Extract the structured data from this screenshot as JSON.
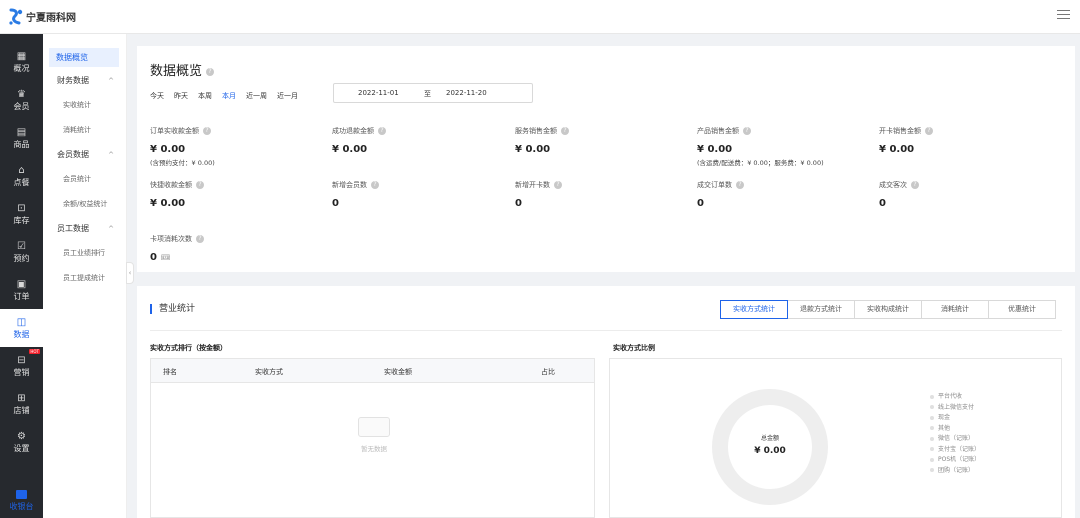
{
  "app": {
    "logo_text": "宁夏雨科网"
  },
  "leftnav": [
    {
      "label": "概况",
      "icon": "grid-icon"
    },
    {
      "label": "会员",
      "icon": "crown-icon"
    },
    {
      "label": "商品",
      "icon": "box-icon"
    },
    {
      "label": "点餐",
      "icon": "dish-icon"
    },
    {
      "label": "库存",
      "icon": "warehouse-icon"
    },
    {
      "label": "预约",
      "icon": "calendar-check-icon"
    },
    {
      "label": "订单",
      "icon": "order-icon"
    },
    {
      "label": "数据",
      "icon": "chart-icon"
    },
    {
      "label": "营销",
      "icon": "shop-icon",
      "badge": "HOT"
    },
    {
      "label": "店铺",
      "icon": "store-icon"
    },
    {
      "label": "设置",
      "icon": "gear-icon"
    }
  ],
  "cashier": {
    "label": "收银台"
  },
  "submenu": {
    "top": "数据概览",
    "groups": [
      {
        "label": "财务数据",
        "items": [
          "实收统计",
          "消耗统计"
        ]
      },
      {
        "label": "会员数据",
        "items": [
          "会员统计",
          "余额/权益统计"
        ]
      },
      {
        "label": "员工数据",
        "items": [
          "员工业绩排行",
          "员工提成统计"
        ]
      }
    ]
  },
  "overview": {
    "title": "数据概览",
    "date_tabs": [
      "今天",
      "昨天",
      "本周",
      "本月",
      "近一周",
      "近一月"
    ],
    "active_tab": "本月",
    "date_start": "2022-11-01",
    "date_sep": "至",
    "date_end": "2022-11-20",
    "metrics": [
      {
        "label": "订单实收款金额",
        "value": "¥ 0.00",
        "note": "(含预约支付：¥ 0.00)"
      },
      {
        "label": "成功退款金额",
        "value": "¥ 0.00"
      },
      {
        "label": "服务销售金额",
        "value": "¥ 0.00"
      },
      {
        "label": "产品销售金额",
        "value": "¥ 0.00",
        "note": "(含运费/配送费：¥ 0.00；服务费：¥ 0.00)"
      },
      {
        "label": "开卡销售金额",
        "value": "¥ 0.00"
      },
      {
        "label": "快捷收款金额",
        "value": "¥ 0.00"
      },
      {
        "label": "新增会员数",
        "value": "0"
      },
      {
        "label": "新增开卡数",
        "value": "0"
      },
      {
        "label": "成交订单数",
        "value": "0"
      },
      {
        "label": "成交客次",
        "value": "0"
      },
      {
        "label": "卡项消耗次数",
        "value": "0",
        "unit": "🎟"
      }
    ]
  },
  "business": {
    "title": "营业统计",
    "tabs": [
      "实收方式统计",
      "退款方式统计",
      "实收构成统计",
      "消耗统计",
      "优惠统计"
    ],
    "active_tab": 0,
    "rank_title": "实收方式排行（按金额）",
    "table_headers": [
      "排名",
      "实收方式",
      "实收金额",
      "占比"
    ],
    "empty_text": "暂无数据",
    "ratio_title": "实收方式比例",
    "donut_label": "总金额",
    "donut_value": "¥ 0.00",
    "legend": [
      "平台代收",
      "线上微信支付",
      "现金",
      "其他",
      "微信（记账）",
      "支付宝（记账）",
      "POS机（记账）",
      "团购（记账）"
    ],
    "colors": {
      "accent": "#1e63e9",
      "donut": "#eeeeee",
      "legend_dot": "#e0e0e0"
    }
  }
}
